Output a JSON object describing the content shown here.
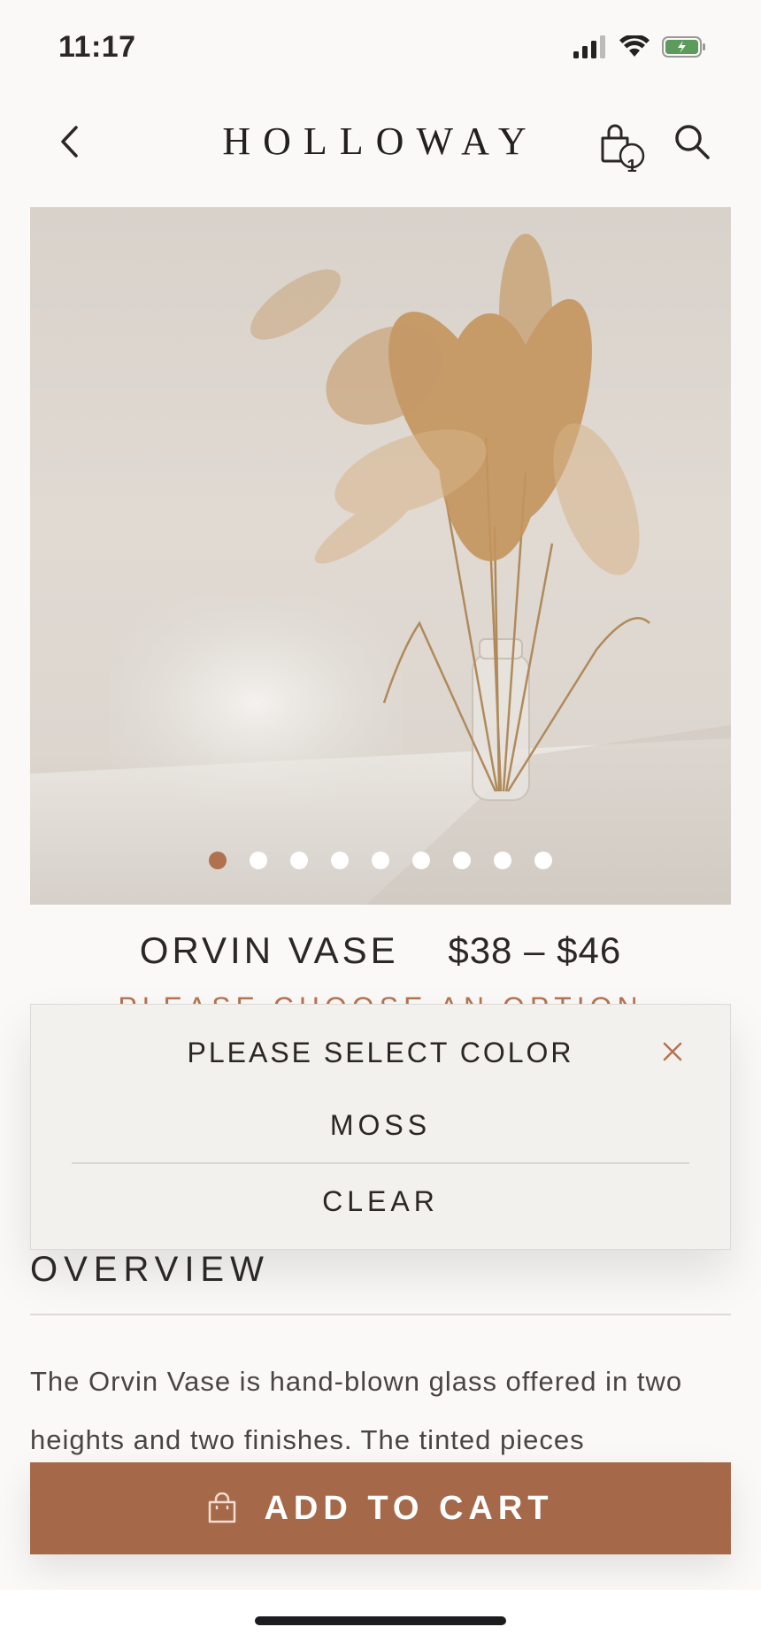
{
  "status_bar": {
    "time": "11:17"
  },
  "header": {
    "brand": "HOLLOWAY",
    "cart_count": "1"
  },
  "hero": {
    "slide_count": 9,
    "active_slide": 1
  },
  "product": {
    "name": "ORVIN VASE",
    "price": "$38 – $46",
    "choose_hint": "PLEASE CHOOSE AN OPTION"
  },
  "selector": {
    "title": "PLEASE SELECT  COLOR",
    "options": [
      "MOSS",
      "CLEAR"
    ]
  },
  "overview": {
    "heading": "OVERVIEW",
    "text": "The Orvin Vase is hand-blown glass offered in two heights and two finishes. The tinted pieces"
  },
  "cta": {
    "label": "ADD TO CART"
  },
  "colors": {
    "accent": "#a5694a",
    "dot_active": "#b0714f",
    "close_icon": "#b57351"
  }
}
